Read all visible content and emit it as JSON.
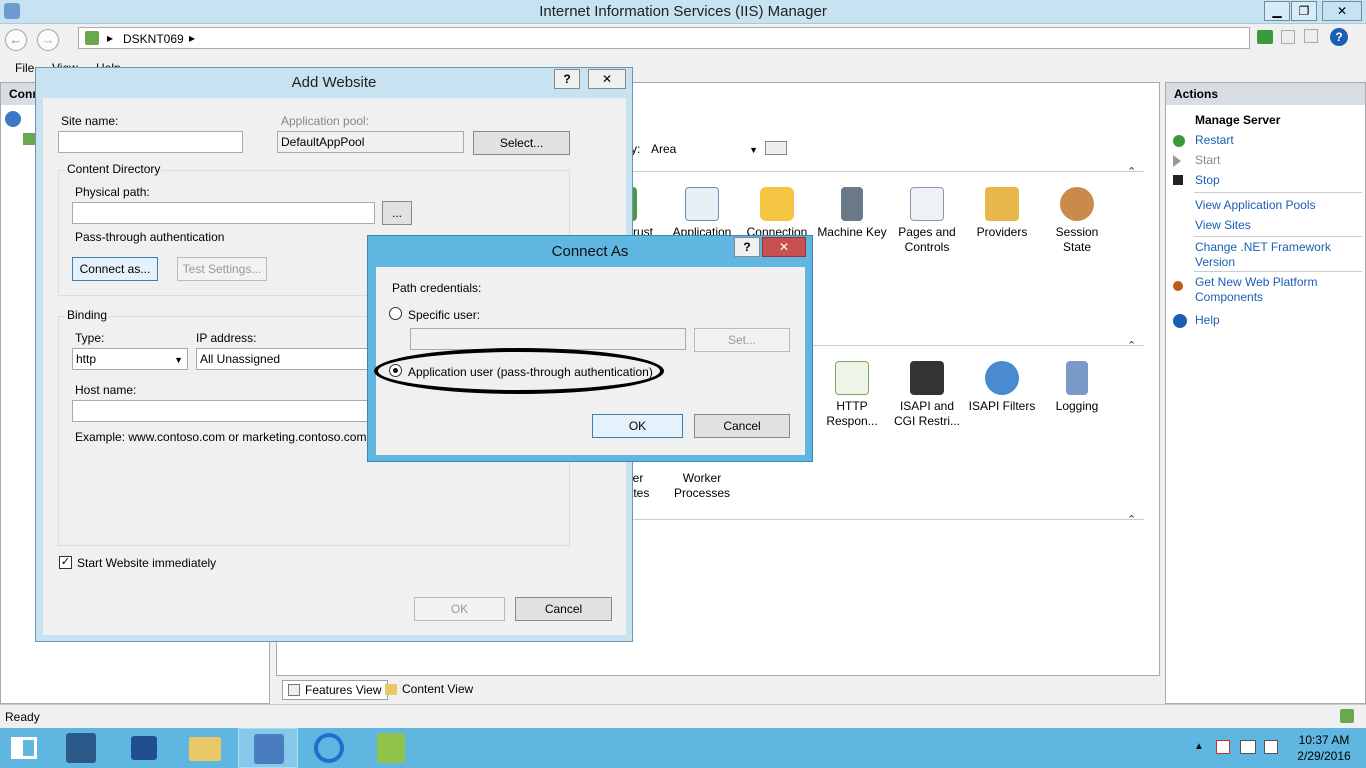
{
  "window": {
    "title": "Internet Information Services (IIS) Manager",
    "controls": {
      "minimize": "▁",
      "maximize": "❐",
      "close": "✕"
    }
  },
  "address_bar": {
    "path": "DSKNT069",
    "separator": "▸"
  },
  "menu": {
    "file": "File",
    "view": "View",
    "help": "Help"
  },
  "connections": {
    "title": "Conn"
  },
  "center": {
    "group_by_label": "y:",
    "group_by_value": "Area",
    "features_row1": [
      "rust",
      "Application",
      "Connection",
      "Machine Key",
      "Pages and Controls",
      "Providers",
      "Session State"
    ],
    "features_row2": [
      "HTTP Respon...",
      "ISAPI and CGI Restri...",
      "ISAPI Filters",
      "Logging"
    ],
    "features_row3": [
      "er\nates",
      "Worker Processes"
    ]
  },
  "view_tabs": {
    "features": "Features View",
    "content": "Content View"
  },
  "actions": {
    "title": "Actions",
    "section": "Manage Server",
    "restart": "Restart",
    "start": "Start",
    "stop": "Stop",
    "view_app_pools": "View Application Pools",
    "view_sites": "View Sites",
    "change_net": "Change .NET Framework Version",
    "get_web_platform": "Get New Web Platform Components",
    "help": "Help"
  },
  "status": {
    "text": "Ready"
  },
  "taskbar": {
    "time": "10:37 AM",
    "date": "2/29/2016"
  },
  "add_website": {
    "title": "Add Website",
    "help_btn": "?",
    "close_btn": "✕",
    "site_name_label": "Site name:",
    "site_name_value": "",
    "app_pool_label": "Application pool:",
    "app_pool_value": "DefaultAppPool",
    "select_btn": "Select...",
    "content_dir_label": "Content Directory",
    "physical_path_label": "Physical path:",
    "physical_path_value": "",
    "browse_btn": "...",
    "passthrough_label": "Pass-through authentication",
    "connect_as_btn": "Connect as...",
    "test_settings_btn": "Test Settings...",
    "binding_label": "Binding",
    "type_label": "Type:",
    "type_value": "http",
    "ip_label": "IP address:",
    "ip_value": "All Unassigned",
    "host_label": "Host name:",
    "host_value": "",
    "example_text": "Example: www.contoso.com or marketing.contoso.com",
    "start_immediately_label": "Start Website immediately",
    "start_immediately_checked": true,
    "ok_btn": "OK",
    "cancel_btn": "Cancel"
  },
  "connect_as": {
    "title": "Connect As",
    "help_btn": "?",
    "close_btn": "✕",
    "path_credentials_label": "Path credentials:",
    "specific_user_label": "Specific user:",
    "specific_user_value": "",
    "set_btn": "Set...",
    "app_user_label": "Application user (pass-through authentication)",
    "selected": "application_user",
    "ok_btn": "OK",
    "cancel_btn": "Cancel"
  },
  "colors": {
    "title_bar": "#c7e2f0",
    "dialog_active": "#5fb6e0",
    "link": "#1a5fb4",
    "close_red": "#c75050"
  }
}
